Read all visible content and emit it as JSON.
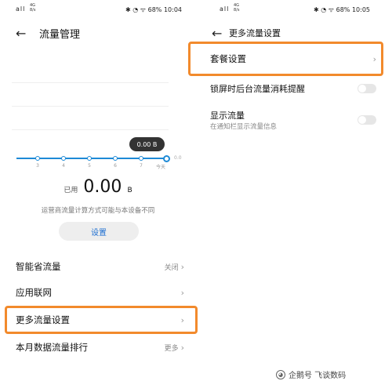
{
  "left": {
    "status": {
      "signal": "all",
      "network": "4G\n8/s",
      "right": "✱ ◔ ᯤ 68% 10:04"
    },
    "header": {
      "back_icon": "back-arrow-icon",
      "title": "流量管理"
    },
    "chart": {
      "tooltip": "0.00 B",
      "ticks": [
        "3",
        "4",
        "5",
        "6",
        "7",
        "今天"
      ],
      "unit": "0.0"
    },
    "used": {
      "label": "已用",
      "value": "0.00",
      "unit": "B"
    },
    "note": "运营商流量计算方式可能与本设备不同",
    "setup_button": "设置",
    "rows": [
      {
        "label": "智能省流量",
        "value": "关闭"
      },
      {
        "label": "应用联网",
        "value": ""
      },
      {
        "label": "更多流量设置",
        "value": ""
      },
      {
        "label": "本月数据流量排行",
        "value": "更多"
      }
    ]
  },
  "right": {
    "status": {
      "signal": "all",
      "network": "4G\n8/s",
      "right": "✱ ◔ ᯤ 68% 10:05"
    },
    "header": {
      "back_icon": "back-arrow-icon",
      "title": "更多流量设置"
    },
    "rows": [
      {
        "label": "套餐设置"
      },
      {
        "label": "锁屏时后台流量消耗提醒"
      },
      {
        "label": "显示流量",
        "sub": "在通知栏显示流量信息"
      }
    ]
  },
  "watermark": "企鹅号 飞谈数码",
  "accent": "#f28a2c",
  "link_color": "#1e6fd1"
}
